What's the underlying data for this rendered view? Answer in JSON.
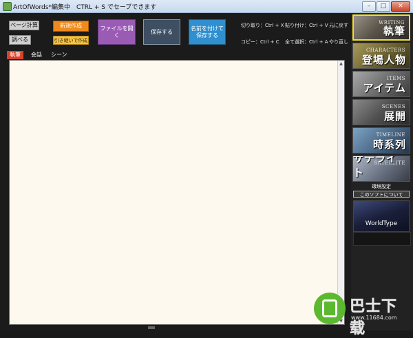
{
  "window": {
    "title": "ArtOfWords*編集中　CTRL + S でセーブできます",
    "controls": {
      "minimize": "–",
      "maximize": "□",
      "close": "✕"
    }
  },
  "toolbar": {
    "page_calc": "ページ計算",
    "search": "調べる",
    "new": "新規作成",
    "inherit_new": "引き継いで作成",
    "open_file": "ファイルを開く",
    "save": "保存する",
    "save_as_line1": "名前を付けて",
    "save_as_line2": "保存する"
  },
  "shortcuts": {
    "cut": "切り取り：Ctrl + X",
    "paste": "貼り付け：Ctrl + V",
    "undo": "元に戻す",
    "copy": "コピー：Ctrl + C",
    "select_all": "全て選択：Ctrl + A",
    "redo": "やり直し"
  },
  "tabs": [
    {
      "label": "執筆",
      "active": true
    },
    {
      "label": "会話",
      "active": false
    },
    {
      "label": "シーン",
      "active": false
    }
  ],
  "editor": {
    "content": ""
  },
  "sidebar": {
    "panels": [
      {
        "en": "WRITING",
        "jp": "執筆",
        "active": true
      },
      {
        "en": "CHARACTERS",
        "jp": "登場人物",
        "active": false
      },
      {
        "en": "ITEMS",
        "jp": "アイテム",
        "active": false
      },
      {
        "en": "SCENES",
        "jp": "展開",
        "active": false
      },
      {
        "en": "TIMELINE",
        "jp": "時系列",
        "active": false
      },
      {
        "en": "SATELLITE",
        "jp": "サテライト",
        "active": false
      }
    ],
    "env_settings": "環境設定",
    "about": "このソフトについて",
    "worldtype": "WorldType"
  },
  "watermark": {
    "title": "巴士下载",
    "url": "www.11684.com"
  }
}
